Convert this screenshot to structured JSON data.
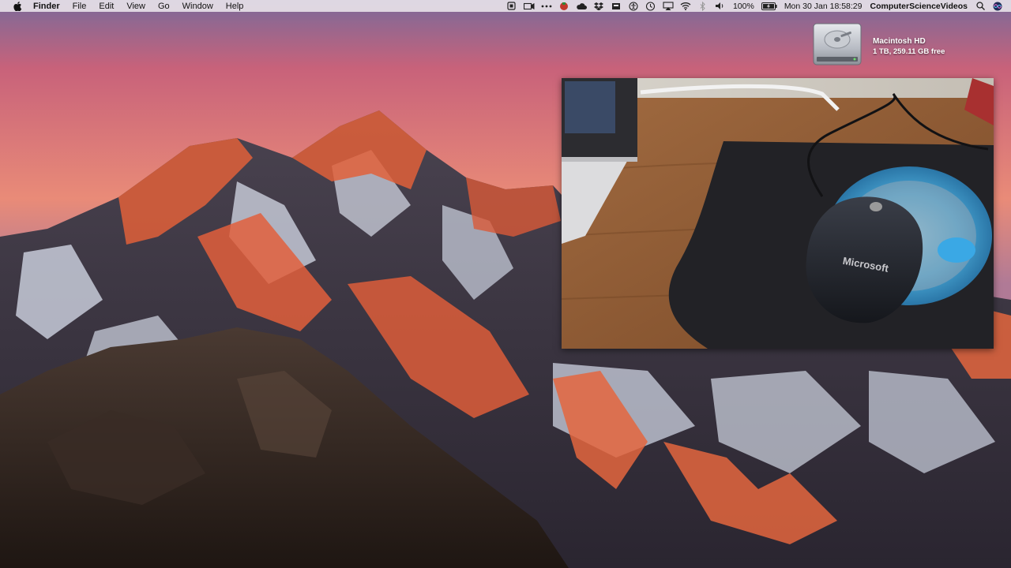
{
  "menubar": {
    "app_name": "Finder",
    "menus": [
      "File",
      "Edit",
      "View",
      "Go",
      "Window",
      "Help"
    ],
    "battery": "100%",
    "datetime": "Mon 30 Jan  18:58:29",
    "user": "ComputerScienceVideos",
    "status_icons": [
      "scan-icon",
      "screen-record-icon",
      "dots-icon",
      "evernote-icon",
      "cloud-icon",
      "dropbox-icon",
      "backup-icon",
      "accessibility-icon",
      "time-machine-icon",
      "airplay-icon",
      "wifi-icon",
      "bluetooth-icon",
      "volume-icon",
      "battery-icon",
      "search-icon",
      "siri-icon"
    ]
  },
  "desktop": {
    "disk": {
      "name": "Macintosh HD",
      "info": "1 TB, 259.11 GB free"
    }
  },
  "video": {
    "mouse_brand": "Microsoft"
  },
  "colors": {
    "menubar_bg": "#ece6ec",
    "sky_top": "#c8627a",
    "sky_bottom": "#e98b78",
    "mouse_glow": "#4fb6e8"
  }
}
